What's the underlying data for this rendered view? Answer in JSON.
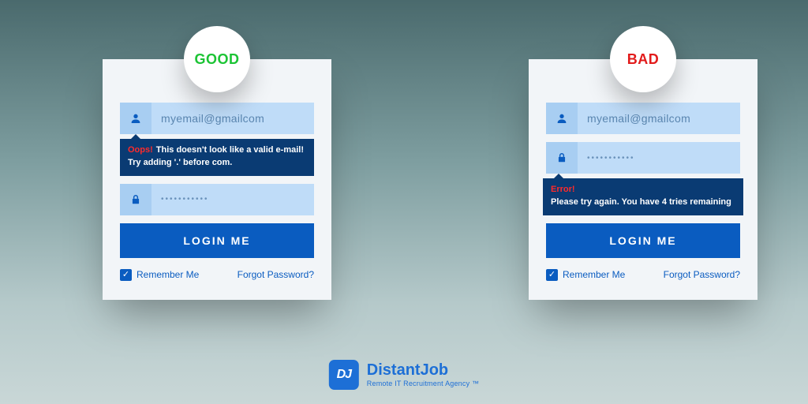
{
  "good": {
    "badge": "GOOD",
    "email": "myemail@gmailcom",
    "password_mask": "•••••••••••",
    "error_prefix": "Oops!",
    "error_line1": "This doesn't look like a valid e-mail!",
    "error_line2": "Try adding '.' before com.",
    "login": "LOGIN ME",
    "remember": "Remember Me",
    "forgot": "Forgot Password?"
  },
  "bad": {
    "badge": "BAD",
    "email": "myemail@gmailcom",
    "password_mask": "•••••••••••",
    "error_prefix": "Error!",
    "error_line": "Please try again. You have 4 tries remaining",
    "login": "LOGIN ME",
    "remember": "Remember Me",
    "forgot": "Forgot Password?"
  },
  "brand": {
    "logo_text": "DJ",
    "name": "DistantJob",
    "tagline": "Remote IT Recruitment Agency ™"
  }
}
